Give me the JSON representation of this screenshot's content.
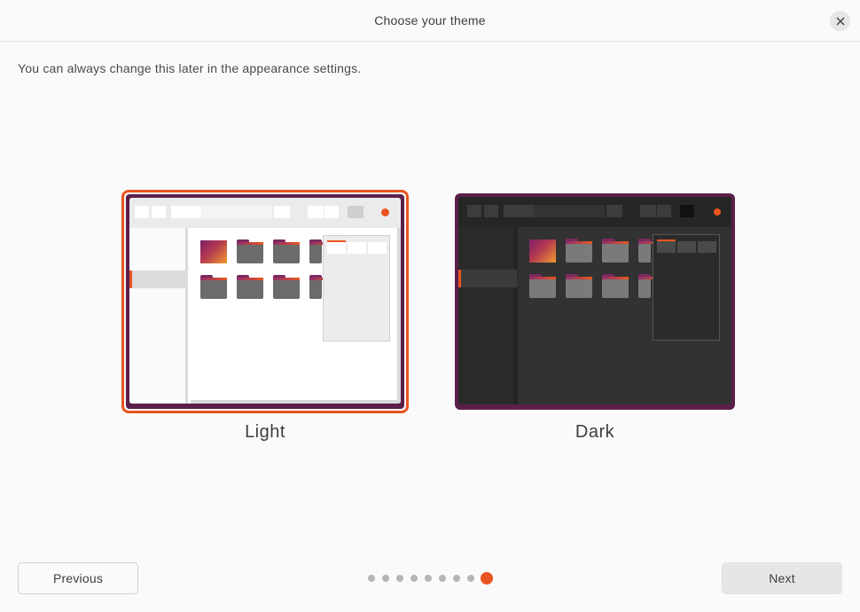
{
  "header": {
    "title": "Choose your theme",
    "close_icon": "close-icon"
  },
  "subtitle": "You can always change this later in the appearance settings.",
  "themes": [
    {
      "label": "Light",
      "selected": true
    },
    {
      "label": "Dark",
      "selected": false
    }
  ],
  "footer": {
    "previous_label": "Previous",
    "next_label": "Next",
    "pages_total": 9,
    "current_page": 9
  },
  "colors": {
    "accent": "#e95420",
    "aubergine": "#5b1f4a"
  }
}
